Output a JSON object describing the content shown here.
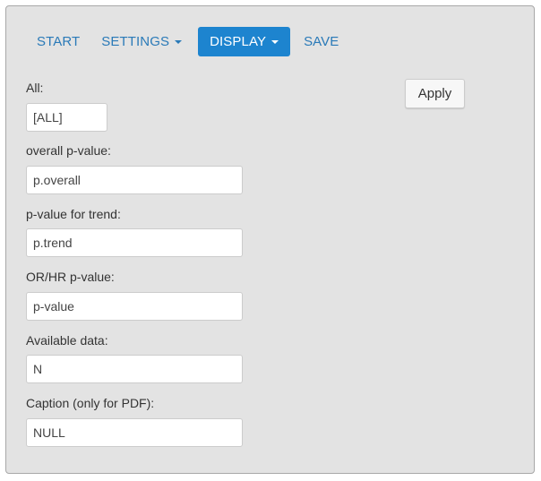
{
  "nav": {
    "start": "START",
    "settings": "SETTINGS",
    "display": "DISPLAY",
    "save": "SAVE"
  },
  "apply_label": "Apply",
  "fields": {
    "all": {
      "label": "All:",
      "value": "[ALL]"
    },
    "overall_p": {
      "label": "overall p-value:",
      "value": "p.overall"
    },
    "trend_p": {
      "label": "p-value for trend:",
      "value": "p.trend"
    },
    "orhr_p": {
      "label": "OR/HR p-value:",
      "value": "p-value"
    },
    "available": {
      "label": "Available data:",
      "value": "N"
    },
    "caption": {
      "label": "Caption (only for PDF):",
      "value": "NULL"
    }
  },
  "colors": {
    "panel_bg": "#e3e3e3",
    "link": "#2a7ab8",
    "active_tab_bg": "#1d84cf"
  }
}
